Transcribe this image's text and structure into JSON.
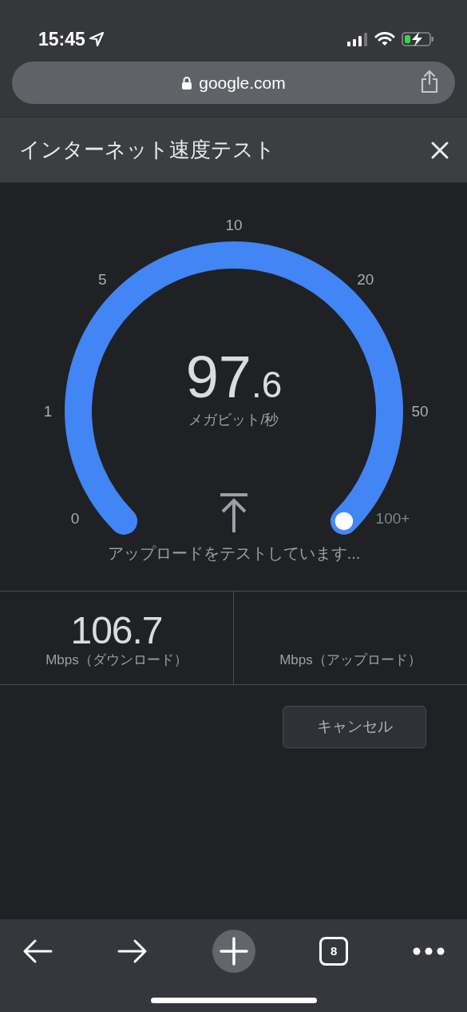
{
  "status_bar": {
    "time": "15:45"
  },
  "address_bar": {
    "url": "google.com"
  },
  "header": {
    "title": "インターネット速度テスト"
  },
  "gauge": {
    "ticks": [
      "0",
      "1",
      "5",
      "10",
      "20",
      "50",
      "100+"
    ],
    "reading_whole": "97",
    "reading_fraction": ".6",
    "unit": "メガビット/秒",
    "status": "アップロードをテストしています..."
  },
  "results": [
    {
      "value": "106.7",
      "label": "Mbps（ダウンロード）"
    },
    {
      "label": "Mbps（アップロード）"
    }
  ],
  "cancel_button": {
    "label": "キャンセル"
  },
  "toolbar": {
    "tab_count": "8"
  }
}
